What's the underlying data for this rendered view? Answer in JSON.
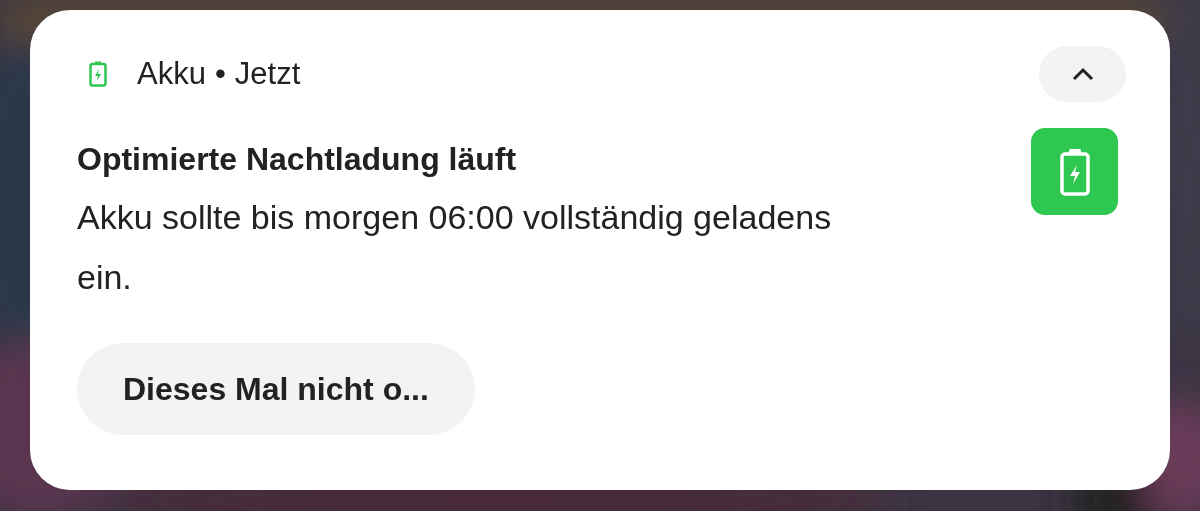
{
  "notification": {
    "app": "Akku",
    "separator": "•",
    "time": "Jetzt",
    "expanded": true,
    "title": "Optimierte Nachtladung läuft",
    "body": "Akku sollte bis morgen 06:00 vollständig geladens ein.",
    "actions": [
      "Dieses Mal nicht o..."
    ]
  }
}
